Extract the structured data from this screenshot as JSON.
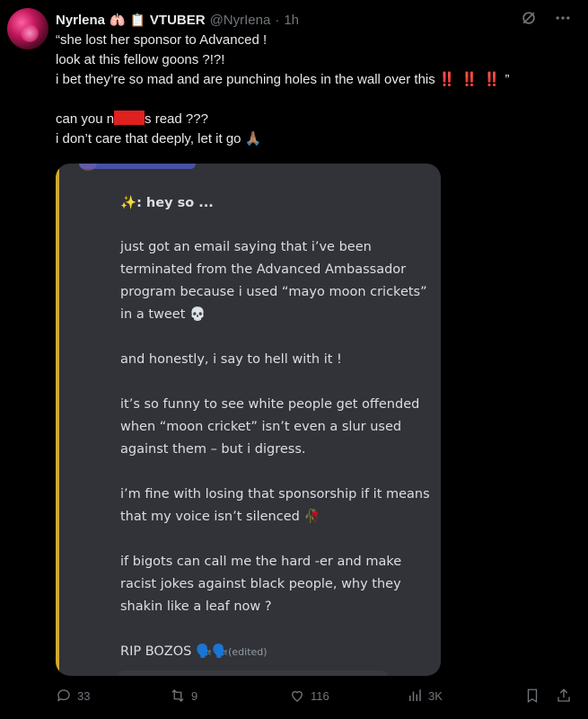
{
  "post": {
    "author_name": "Nyrlena",
    "author_emoji": "🫁",
    "tag_emoji": "📋",
    "tag": "VTUBER",
    "handle": "@NyrIena",
    "dot": "·",
    "time": "1h",
    "lines": [
      "“she lost her sponsor to Advanced !",
      "look at this fellow goons ?!?!",
      "i bet they’re so mad and are punching holes in the wall over this",
      "can you n",
      "s read ???",
      "i don’t care that deeply, let it go"
    ],
    "bangs": "‼️ ‼️ ‼️",
    "close_quote": "”",
    "pray_emoji": "🙏🏽"
  },
  "embed": {
    "sparkle": "✨",
    "lead": ": hey so ...",
    "p1": "just got an email saying that i’ve been terminated from the Advanced Ambassador program because i used “mayo moon crickets” in a tweet",
    "skull": "💀",
    "p2": "and honestly, i say to hell with it !",
    "p3": "it’s so funny to see white people get offended when “moon cricket” isn’t even a slur used against them – but i digress.",
    "p4": "i’m fine with losing that sponsorship if it means that my voice isn’t silenced",
    "flower": "🥀",
    "p5": "if bigots can call me the hard -er and make racist jokes against black people, why they shakin like a leaf now ?",
    "p6": "RIP BOZOS",
    "talk": "🗣️🗣️",
    "edited": "(edited)"
  },
  "actions": {
    "replies": "33",
    "reposts": "9",
    "likes": "116",
    "views": "3K"
  }
}
